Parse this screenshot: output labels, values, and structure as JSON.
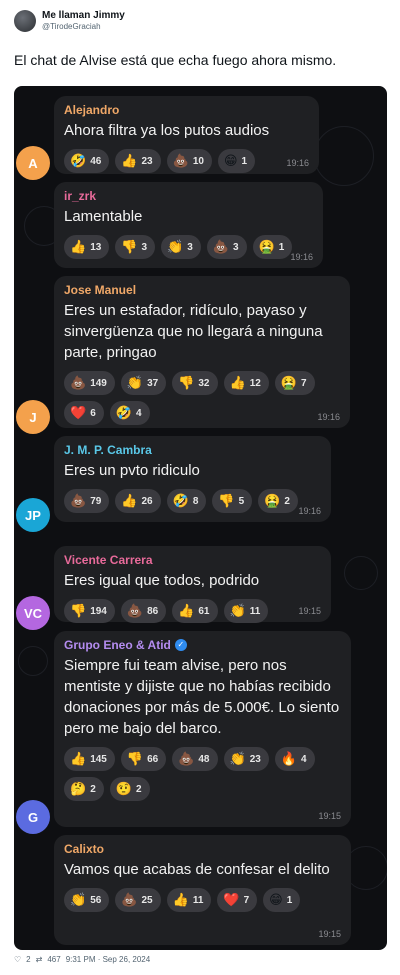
{
  "tweet": {
    "author_name": "Me llaman Jimmy",
    "author_handle": "@TirodeGraciah",
    "text": "El chat de Alvise está que echa fuego ahora mismo.",
    "likes": "2",
    "retweets": "467",
    "timestamp": "9:31 PM · Sep 26, 2024",
    "like_icon": "heart-icon",
    "retweet_icon": "retweet-icon"
  },
  "chat": {
    "messages": [
      {
        "sender": "Alejandro",
        "sender_color": "#f0a868",
        "text": "Ahora filtra ya los putos audios",
        "time": "19:16",
        "avatar_initials": "A",
        "avatar_color": "#f4a14c",
        "reactions": [
          {
            "emoji": "🤣",
            "count": "46"
          },
          {
            "emoji": "👍",
            "count": "23"
          },
          {
            "emoji": "💩",
            "count": "10"
          },
          {
            "emoji": "😁",
            "count": "1"
          }
        ]
      },
      {
        "sender": "ir_zrk",
        "sender_color": "#e86a9a",
        "text": "Lamentable",
        "time": "19:16",
        "avatar_initials": "",
        "avatar_color": "#1f2023",
        "reactions": [
          {
            "emoji": "👍",
            "count": "13"
          },
          {
            "emoji": "👎",
            "count": "3"
          },
          {
            "emoji": "👏",
            "count": "3"
          },
          {
            "emoji": "💩",
            "count": "3"
          },
          {
            "emoji": "🤮",
            "count": "1"
          }
        ]
      },
      {
        "sender": "Jose Manuel",
        "sender_color": "#f0a868",
        "text": "Eres un estafador, ridículo, payaso y sinvergüenza que no llegará a ninguna parte, pringao",
        "time": "19:16",
        "avatar_initials": "J",
        "avatar_color": "#f4a14c",
        "reactions": [
          {
            "emoji": "💩",
            "count": "149"
          },
          {
            "emoji": "👏",
            "count": "37"
          },
          {
            "emoji": "👎",
            "count": "32"
          },
          {
            "emoji": "👍",
            "count": "12"
          },
          {
            "emoji": "🤮",
            "count": "7"
          },
          {
            "emoji": "❤️",
            "count": "6"
          },
          {
            "emoji": "🤣",
            "count": "4"
          }
        ]
      },
      {
        "sender": "J. M. P. Cambra",
        "sender_color": "#5ac8e8",
        "text": "Eres un pvto ridiculo",
        "time": "19:16",
        "avatar_initials": "JP",
        "avatar_color": "#1aa6d6",
        "reactions": [
          {
            "emoji": "💩",
            "count": "79"
          },
          {
            "emoji": "👍",
            "count": "26"
          },
          {
            "emoji": "🤣",
            "count": "8"
          },
          {
            "emoji": "👎",
            "count": "5"
          },
          {
            "emoji": "🤮",
            "count": "2"
          }
        ]
      },
      {
        "sender": "Vicente Carrera",
        "sender_color": "#e86a9a",
        "text": "Eres igual que todos, podrido",
        "time": "19:15",
        "avatar_initials": "VC",
        "avatar_color": "#b467e0",
        "reactions": [
          {
            "emoji": "👎",
            "count": "194"
          },
          {
            "emoji": "💩",
            "count": "86"
          },
          {
            "emoji": "👍",
            "count": "61"
          },
          {
            "emoji": "👏",
            "count": "11"
          }
        ]
      },
      {
        "sender": "Grupo Eneo & Atid",
        "sender_color": "#b48cf0",
        "verified": "✓",
        "text": "Siempre fui team alvise, pero nos mentiste y dijiste que no habías recibido donaciones por más de 5.000€. Lo siento pero me bajo del barco.",
        "time": "19:15",
        "avatar_initials": "G",
        "avatar_color": "#5b6be0",
        "reactions": [
          {
            "emoji": "👍",
            "count": "145"
          },
          {
            "emoji": "👎",
            "count": "66"
          },
          {
            "emoji": "💩",
            "count": "48"
          },
          {
            "emoji": "👏",
            "count": "23"
          },
          {
            "emoji": "🔥",
            "count": "4"
          },
          {
            "emoji": "🤔",
            "count": "2"
          },
          {
            "emoji": "🤨",
            "count": "2"
          }
        ]
      },
      {
        "sender": "Calixto",
        "sender_color": "#f0a868",
        "text": "Vamos que acabas de confesar el delito",
        "time": "19:15",
        "avatar_initials": "",
        "avatar_color": "#1f2023",
        "reactions": [
          {
            "emoji": "👏",
            "count": "56"
          },
          {
            "emoji": "💩",
            "count": "25"
          },
          {
            "emoji": "👍",
            "count": "11"
          },
          {
            "emoji": "❤️",
            "count": "7"
          },
          {
            "emoji": "😁",
            "count": "1"
          }
        ]
      }
    ]
  }
}
